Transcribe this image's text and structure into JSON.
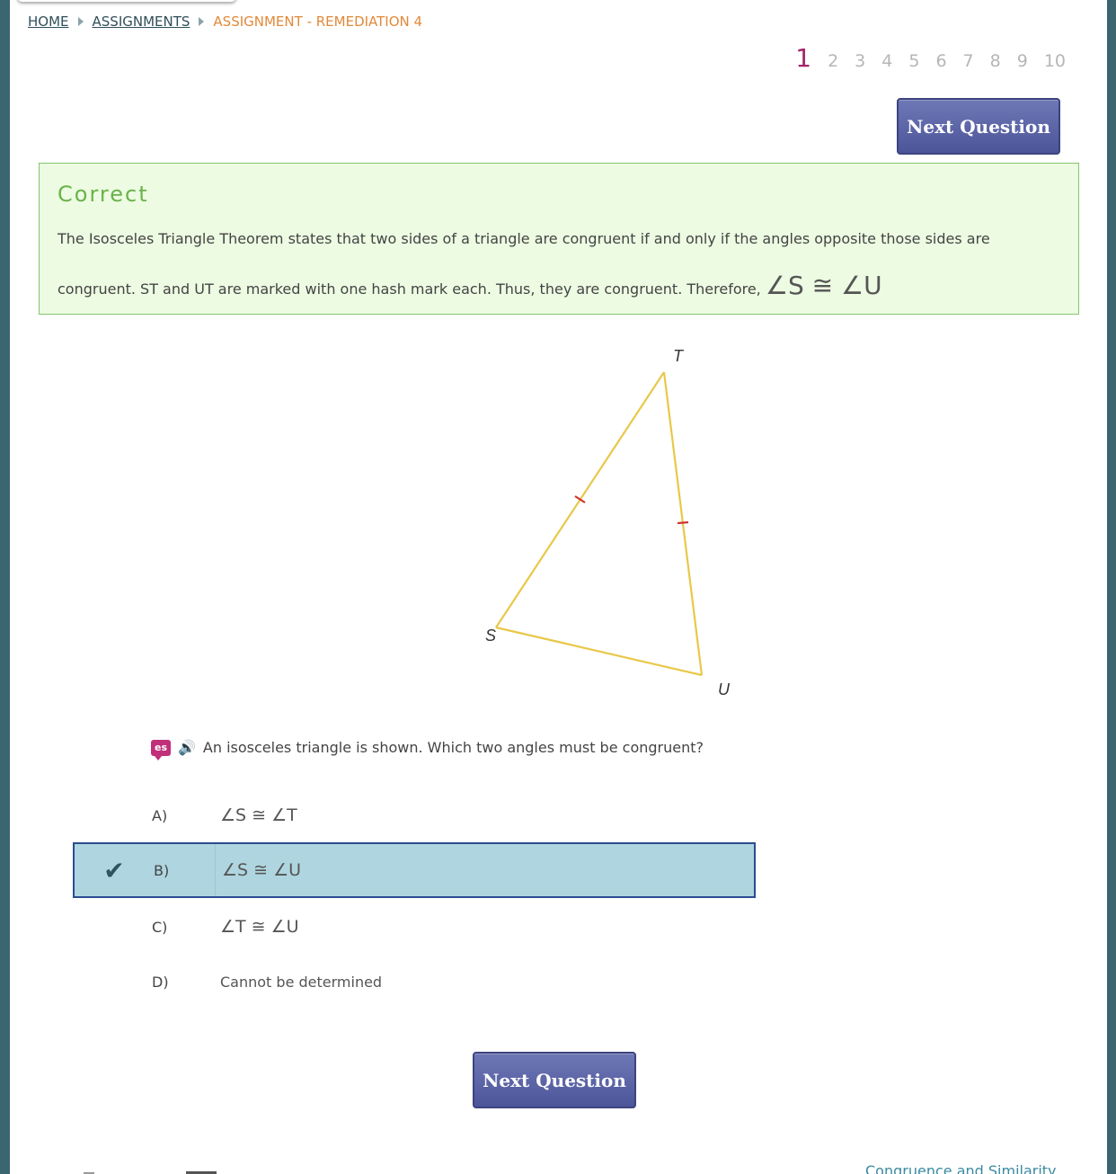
{
  "breadcrumb": {
    "home": "HOME",
    "assignments": "ASSIGNMENTS",
    "current": "ASSIGNMENT - REMEDIATION 4"
  },
  "pager": {
    "pages": [
      "1",
      "2",
      "3",
      "4",
      "5",
      "6",
      "7",
      "8",
      "9",
      "10"
    ],
    "current": "1"
  },
  "next_button_label": "Next Question",
  "feedback": {
    "title": "Correct",
    "text": "The Isosceles Triangle Theorem states that two sides of a triangle are congruent if and only if the angles opposite those sides are congruent. ST and UT are marked with one hash mark each. Thus, they are congruent. Therefore,",
    "math": "∠S ≅ ∠U"
  },
  "figure": {
    "labels": {
      "t": "T",
      "s": "S",
      "u": "U"
    },
    "line_color": "#e8c84a",
    "hash_color": "#d0342c"
  },
  "question": {
    "text": "An isosceles triangle is shown. Which two angles must be congruent?"
  },
  "choices": [
    {
      "letter": "A)",
      "text": "∠S ≅ ∠T",
      "selected": false
    },
    {
      "letter": "B)",
      "text": "∠S ≅ ∠U",
      "selected": true
    },
    {
      "letter": "C)",
      "text": "∠T ≅ ∠U",
      "selected": false
    },
    {
      "letter": "D)",
      "text": "Cannot be determined",
      "selected": false
    }
  ],
  "footer": {
    "link": "Congruence and Similarity"
  }
}
